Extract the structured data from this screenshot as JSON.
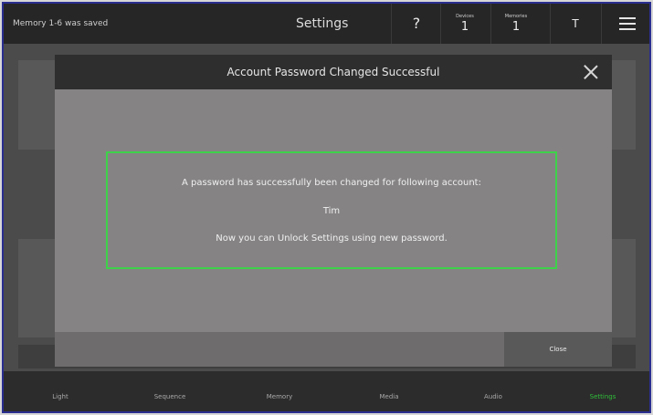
{
  "topbar": {
    "status": "Memory 1-6 was saved",
    "title": "Settings",
    "help": "?",
    "devices_label": "Devices",
    "devices_value": "1",
    "memories_label": "Memories",
    "memories_value": "1",
    "user_initial": "T"
  },
  "dialog": {
    "title": "Account Password Changed Successful",
    "message_line1": "A password has successfully been changed for following account:",
    "account_name": "Tim",
    "message_line3": "Now you can Unlock Settings using new password.",
    "close_button": "Close"
  },
  "nav": {
    "items": [
      "Light",
      "Sequence",
      "Memory",
      "Media",
      "Audio",
      "Settings"
    ],
    "active": "Settings",
    "active_color": "#2fbf3a"
  },
  "colors": {
    "success_border": "#3dd24a",
    "topbar_bg": "#262626",
    "dialog_bg": "#858383"
  }
}
